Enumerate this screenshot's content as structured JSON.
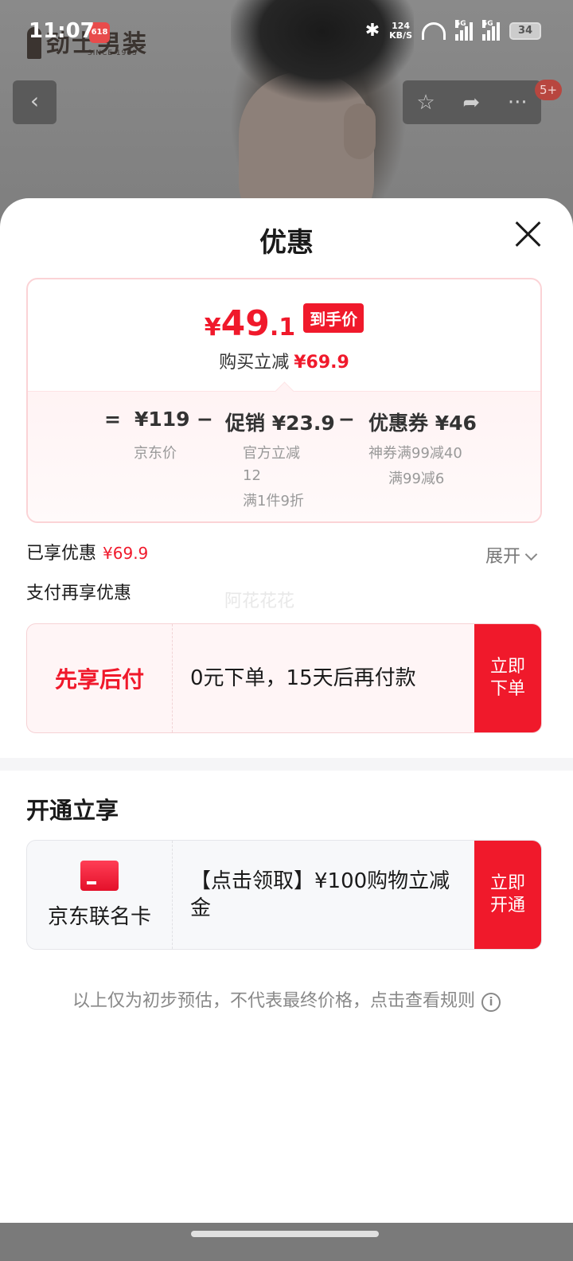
{
  "status_bar": {
    "time": "11:07",
    "speed": "124\nKB/S",
    "speed_value": "124",
    "speed_unit": "KB/S",
    "network_1": "5G",
    "network_2": "5G",
    "battery": "34"
  },
  "background": {
    "brand_name": "劲士男装",
    "brand_since": "SINCE 1983",
    "badge_618": "618",
    "notification_badge": "5+"
  },
  "sheet": {
    "title": "优惠",
    "final_price": {
      "currency": "¥",
      "integer": "49",
      "decimal": ".1",
      "tag": "到手价"
    },
    "instant_reduce": {
      "label": "购买立减",
      "value": "¥69.9"
    },
    "formula": {
      "equals": "=",
      "jd_price": "¥119",
      "jd_price_label": "京东价",
      "minus1": "−",
      "promo": "促销 ¥23.9",
      "promo_detail_1": "官方立减",
      "promo_detail_2": "12",
      "promo_detail_3": "满1件9折",
      "minus2": "−",
      "coupon": "优惠券 ¥46",
      "coupon_detail_1": "神券满99减40",
      "coupon_detail_2": "满99减6"
    },
    "enjoyed": {
      "label": "已享优惠",
      "value": "¥69.9",
      "expand": "展开"
    },
    "pay_more_label": "支付再享优惠",
    "watermark": "阿花花花",
    "bnpl": {
      "title": "先享后付",
      "desc": "0元下单，15天后再付款",
      "button": "立即下单"
    },
    "open_section_title": "开通立享",
    "card_offer": {
      "title": "京东联名卡",
      "desc": "【点击领取】¥100购物立减金",
      "button": "立即开通"
    },
    "disclaimer": "以上仅为初步预估，不代表最终价格，点击查看规则"
  },
  "colors": {
    "accent_red": "#f0192b",
    "card_border": "#fbd3d6"
  },
  "icons": [
    "back-arrow-icon",
    "star-icon",
    "share-icon",
    "more-icon",
    "close-icon",
    "chevron-down-icon",
    "bank-card-icon",
    "info-icon",
    "bluetooth-icon",
    "wifi-icon",
    "signal-icon",
    "battery-icon"
  ]
}
